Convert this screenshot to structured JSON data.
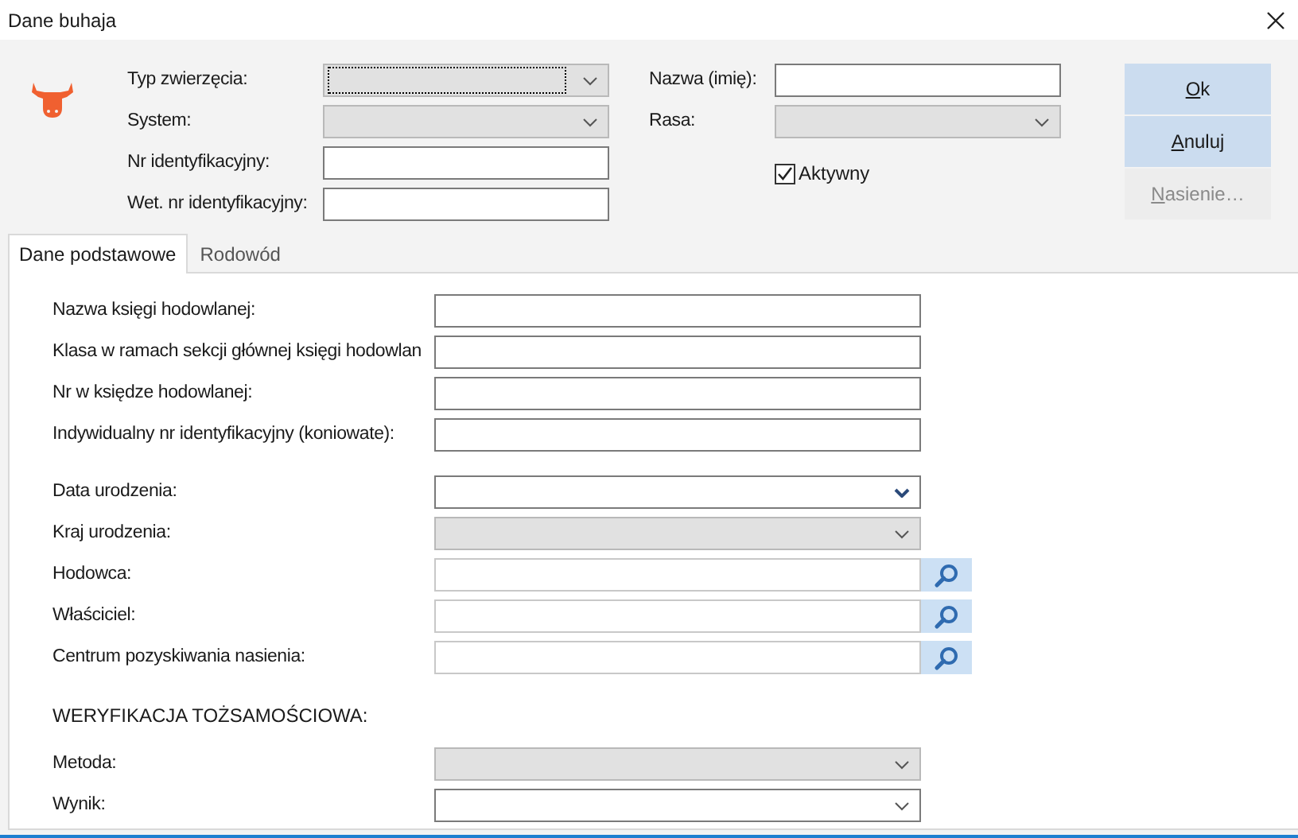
{
  "window": {
    "title": "Dane buhaja"
  },
  "top": {
    "left_fields": [
      {
        "label": "Typ zwierzęcia:",
        "kind": "select",
        "disabled": true,
        "focused": true
      },
      {
        "label": "System:",
        "kind": "select",
        "disabled": true,
        "focused": false
      },
      {
        "label": "Nr identyfikacyjny:",
        "kind": "text",
        "disabled": false,
        "focused": false
      },
      {
        "label": "Wet. nr identyfikacyjny:",
        "kind": "text",
        "disabled": false,
        "focused": false
      }
    ],
    "right_fields": [
      {
        "label": "Nazwa (imię):",
        "kind": "text",
        "disabled": false,
        "focused": false
      },
      {
        "label": "Rasa:",
        "kind": "select",
        "disabled": true,
        "focused": false
      }
    ],
    "checkbox": {
      "label": "Aktywny",
      "checked": true
    },
    "buttons": [
      {
        "label_parts": [
          "O",
          "k"
        ],
        "disabled": false
      },
      {
        "label_parts": [
          "A",
          "nuluj"
        ],
        "disabled": false
      },
      {
        "label_parts": [
          "N",
          "asienie…"
        ],
        "disabled": true
      }
    ]
  },
  "tabs": [
    {
      "label": "Dane podstawowe",
      "selected": true
    },
    {
      "label": "Rodowód",
      "selected": false
    }
  ],
  "panel": {
    "sections": [
      {
        "fields": [
          {
            "label": "Nazwa księgi hodowlanej:",
            "kind": "text",
            "disabled": false
          },
          {
            "label": "Klasa w ramach sekcji głównej księgi hodowlan",
            "kind": "text",
            "disabled": false
          },
          {
            "label": "Nr w księdze hodowlanej:",
            "kind": "text",
            "disabled": false
          },
          {
            "label": "Indywidualny nr identyfikacyjny (koniowate):",
            "kind": "text",
            "disabled": false
          }
        ]
      },
      {
        "fields": [
          {
            "label": "Data urodzenia:",
            "kind": "date",
            "disabled": false
          },
          {
            "label": "Kraj urodzenia:",
            "kind": "select",
            "disabled": true
          },
          {
            "label": "Hodowca:",
            "kind": "lookup",
            "disabled": false
          },
          {
            "label": "Właściciel:",
            "kind": "lookup",
            "disabled": false
          },
          {
            "label": "Centrum pozyskiwania nasienia:",
            "kind": "lookup",
            "disabled": false
          }
        ]
      },
      {
        "heading": "WERYFIKACJA TOŻSAMOŚCIOWA:",
        "fields": [
          {
            "label": "Metoda:",
            "kind": "select",
            "disabled": true
          },
          {
            "label": "Wynik:",
            "kind": "select",
            "disabled": false
          }
        ]
      }
    ]
  }
}
